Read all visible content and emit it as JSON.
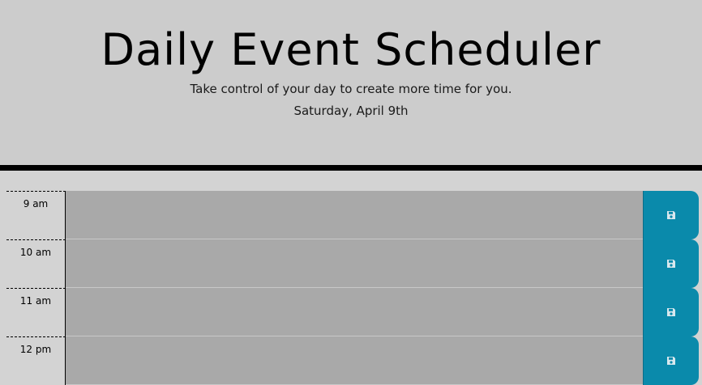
{
  "header": {
    "title": "Daily Event Scheduler",
    "subtitle": "Take control of your day to create more time for you.",
    "current_day": "Saturday, April 9th"
  },
  "colors": {
    "page_bg": "#d3d3d3",
    "header_bg": "#cccccc",
    "past_block": "#a9a9a9",
    "save_button": "#0a8aab",
    "save_icon": "#d8e8ee"
  },
  "time_blocks": [
    {
      "hour": "9 am",
      "event": "",
      "save_icon": "save-icon"
    },
    {
      "hour": "10 am",
      "event": "",
      "save_icon": "save-icon"
    },
    {
      "hour": "11 am",
      "event": "",
      "save_icon": "save-icon"
    },
    {
      "hour": "12 pm",
      "event": "",
      "save_icon": "save-icon"
    }
  ]
}
